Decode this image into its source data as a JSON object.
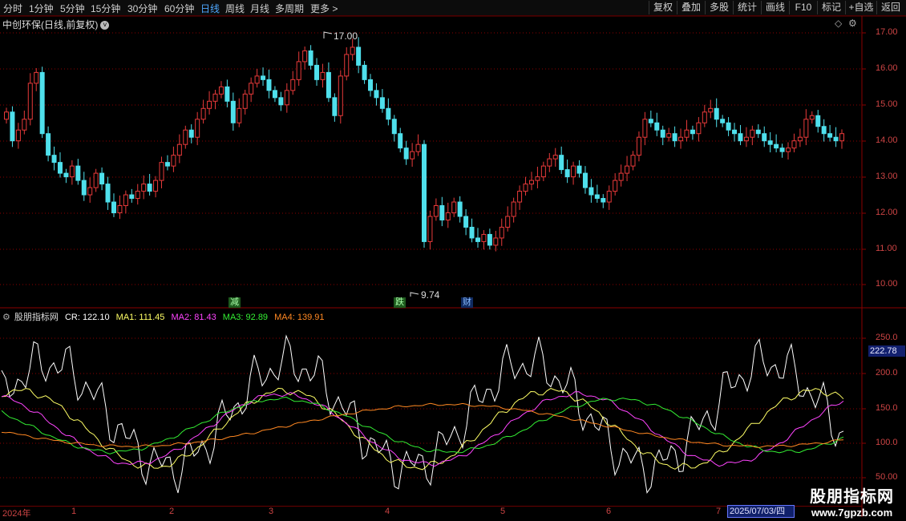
{
  "toolbar": {
    "tabs": [
      "分时",
      "1分钟",
      "5分钟",
      "15分钟",
      "30分钟",
      "60分钟",
      "日线",
      "周线",
      "月线",
      "多周期",
      "更多"
    ],
    "more_arrow": ">",
    "right_buttons": [
      "复权",
      "叠加",
      "多股",
      "统计",
      "画线",
      "F10",
      "标记",
      "+自选",
      "返回"
    ]
  },
  "main_pane": {
    "title": "中创环保(日线,前复权)",
    "high_label": "17.00",
    "low_label": "9.74",
    "y_ticks": [
      "17.00",
      "16.00",
      "15.00",
      "14.00",
      "13.00",
      "12.00",
      "11.00",
      "10.00"
    ],
    "badges": [
      "减",
      "跌",
      "财"
    ]
  },
  "indicator_pane": {
    "name": "股朋指标网",
    "cr": "CR: 122.10",
    "ma1": "MA1: 111.45",
    "ma2": "MA2: 81.43",
    "ma3": "MA3: 92.89",
    "ma4": "MA4: 139.91",
    "y_ticks": [
      "250.0",
      "200.0",
      "150.0",
      "100.0",
      "50.00"
    ],
    "current_value": "222.78"
  },
  "date_axis": {
    "labels": [
      "2024年",
      "1",
      "2",
      "3",
      "4",
      "5",
      "6",
      "7"
    ],
    "cursor_date": "2025/07/03/四"
  },
  "watermark": {
    "line1": "股朋指标网",
    "line2": "www.7gpzb.com"
  },
  "colors": {
    "up": "#e83a3a",
    "down": "#4fe0ec",
    "cr": "#ffffff",
    "ma1": "#ffff66",
    "ma2": "#ff44ff",
    "ma3": "#33ee33",
    "ma4": "#ff8822",
    "grid": "#8b0000"
  }
}
